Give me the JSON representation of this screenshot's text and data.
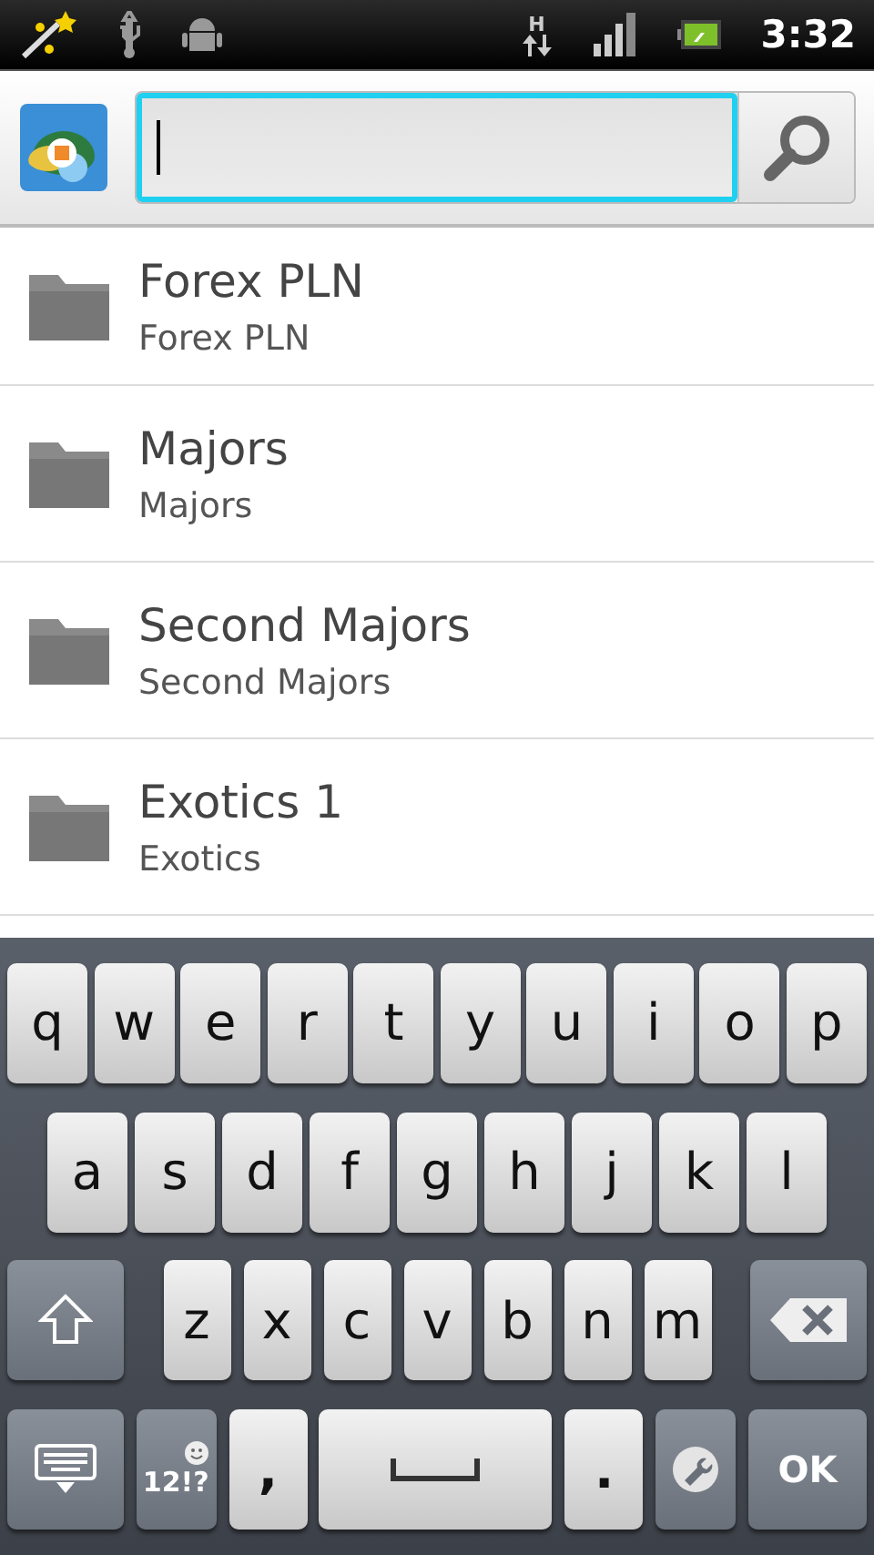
{
  "status_bar": {
    "network_type": "H",
    "time": "3:32"
  },
  "search": {
    "focused": true
  },
  "folders": [
    {
      "title": "Forex PLN",
      "subtitle": "Forex PLN"
    },
    {
      "title": "Majors",
      "subtitle": "Majors"
    },
    {
      "title": "Second Majors",
      "subtitle": "Second Majors"
    },
    {
      "title": "Exotics 1",
      "subtitle": "Exotics"
    }
  ],
  "keyboard": {
    "rows": [
      [
        "q",
        "w",
        "e",
        "r",
        "t",
        "y",
        "u",
        "i",
        "o",
        "p"
      ],
      [
        "a",
        "s",
        "d",
        "f",
        "g",
        "h",
        "j",
        "k",
        "l"
      ],
      [
        "z",
        "x",
        "c",
        "v",
        "b",
        "n",
        "m"
      ]
    ],
    "bottom": [
      {
        "kind": "hide"
      },
      {
        "kind": "symbols",
        "label": "12!?"
      },
      {
        "kind": "char",
        "label": ","
      },
      {
        "kind": "space"
      },
      {
        "kind": "char",
        "label": "."
      },
      {
        "kind": "settings"
      },
      {
        "kind": "action",
        "label": "OK"
      }
    ]
  }
}
